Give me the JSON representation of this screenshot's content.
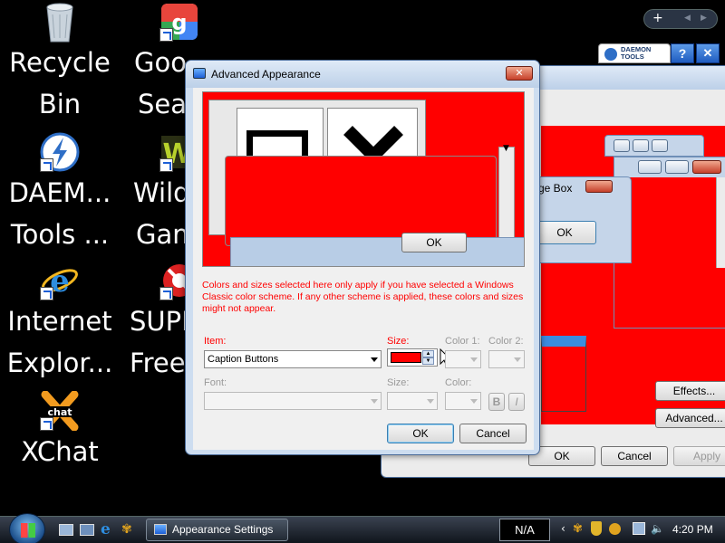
{
  "desktop": {
    "icons": [
      {
        "label_line1": "Recycle",
        "label_line2": "Bin"
      },
      {
        "label_line1": "Goo",
        "label_line2": "Sea"
      },
      {
        "label_line1": "DAEM...",
        "label_line2": "Tools ..."
      },
      {
        "label_line1": "Wild",
        "label_line2": "Gam"
      },
      {
        "label_line1": "Internet",
        "label_line2": "Explor..."
      },
      {
        "label_line1": "SUPE",
        "label_line2": "Free"
      },
      {
        "label_line1": "XChat",
        "label_line2": ""
      }
    ]
  },
  "gadgets": {
    "daemon_label": "DAEMON TOOLS"
  },
  "background_windows": {
    "message_box_title": "ge Box",
    "message_box_ok": "OK",
    "appearance_ok": "OK",
    "appearance_cancel": "Cancel",
    "appearance_apply": "Apply",
    "effects_button": "Effects...",
    "advanced_button": "Advanced..."
  },
  "dialog": {
    "title": "Advanced Appearance",
    "preview_ok": "OK",
    "warning": "Colors and sizes selected here only apply if you have selected a Windows Classic color scheme. If any other scheme is applied, these colors and sizes might not appear.",
    "item_label": "Item:",
    "item_value": "Caption Buttons",
    "size_label": "Size:",
    "color1_label": "Color 1:",
    "color2_label": "Color 2:",
    "font_label": "Font:",
    "font_size_label": "Size:",
    "font_color_label": "Color:",
    "bold_label": "B",
    "italic_label": "I",
    "ok_button": "OK",
    "cancel_button": "Cancel",
    "selected_color": "#ff0000"
  },
  "taskbar": {
    "task_label": "Appearance Settings",
    "language": "N/A",
    "clock": "4:20 PM"
  }
}
